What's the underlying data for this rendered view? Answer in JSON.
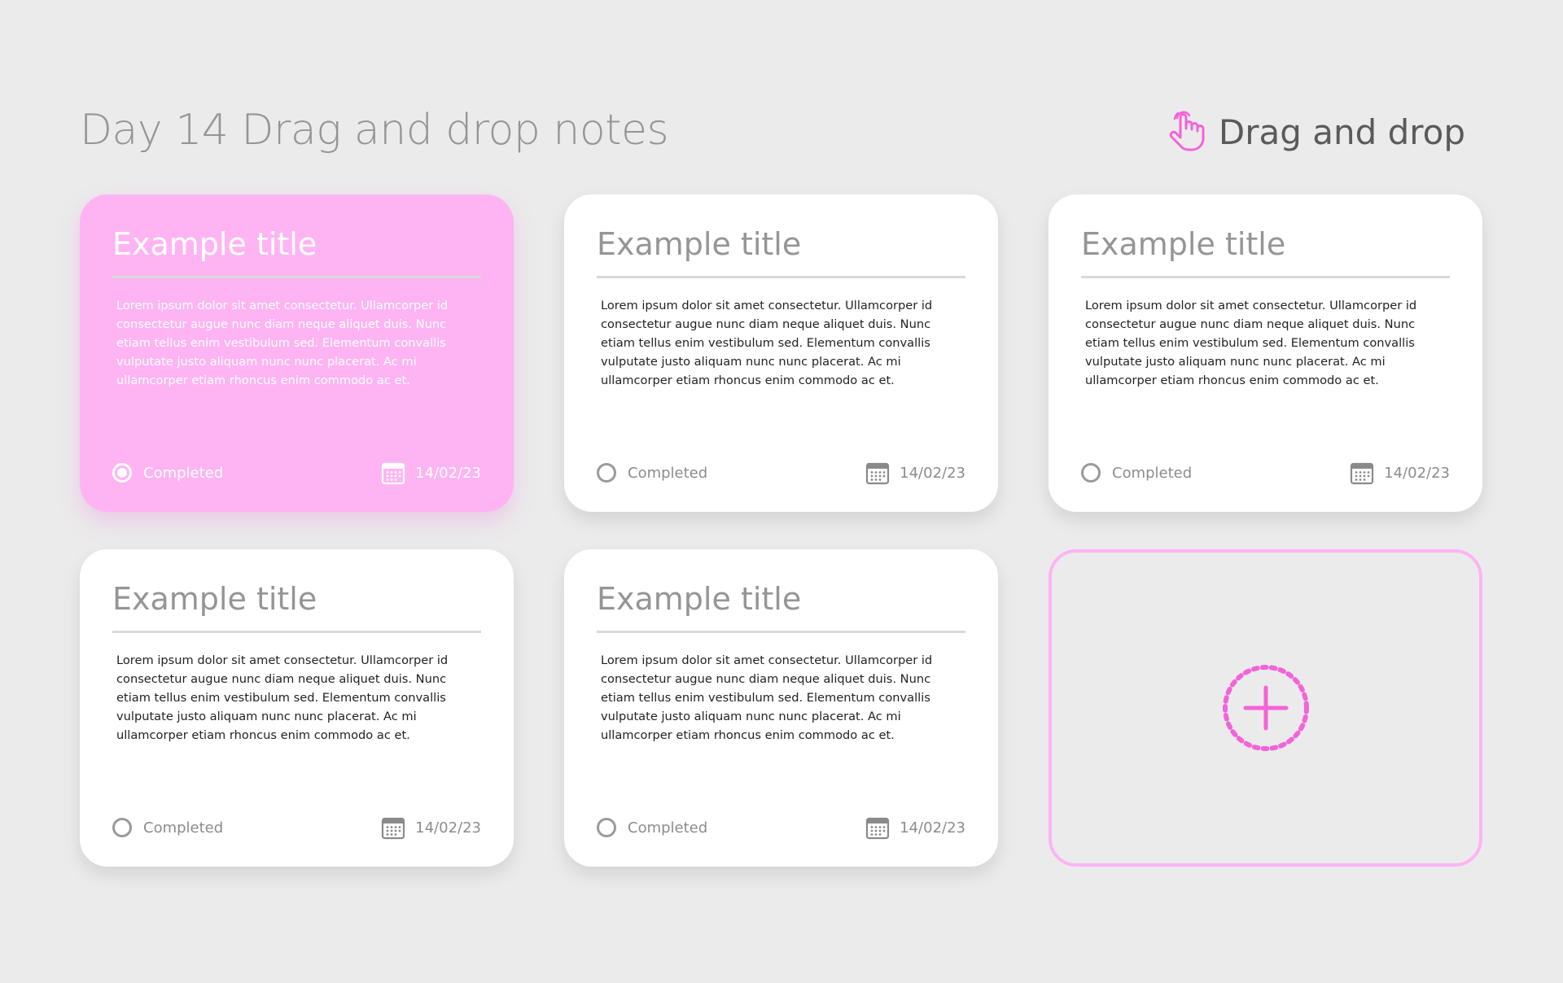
{
  "header": {
    "title": "Day 14 Drag and drop notes",
    "hint_label": "Drag and drop",
    "hint_icon": "pointer-hand-icon"
  },
  "colors": {
    "accent": "#f363d9",
    "active_card": "#feb4f3",
    "background": "#ebebeb",
    "card": "#ffffff"
  },
  "notes": [
    {
      "title": "Example title",
      "body": "Lorem ipsum dolor sit amet consectetur. Ullamcorper id consectetur augue nunc diam neque aliquet duis. Nunc etiam tellus enim vestibulum sed. Elementum convallis vulputate justo aliquam nunc nunc placerat. Ac mi ullamcorper etiam rhoncus enim commodo ac et.",
      "status_label": "Completed",
      "completed": true,
      "date": "14/02/23",
      "active": true
    },
    {
      "title": "Example title",
      "body": "Lorem ipsum dolor sit amet consectetur. Ullamcorper id consectetur augue nunc diam neque aliquet duis. Nunc etiam tellus enim vestibulum sed. Elementum convallis vulputate justo aliquam nunc nunc placerat. Ac mi ullamcorper etiam rhoncus enim commodo ac et.",
      "status_label": "Completed",
      "completed": false,
      "date": "14/02/23",
      "active": false
    },
    {
      "title": "Example title",
      "body": "Lorem ipsum dolor sit amet consectetur. Ullamcorper id consectetur augue nunc diam neque aliquet duis. Nunc etiam tellus enim vestibulum sed. Elementum convallis vulputate justo aliquam nunc nunc placerat. Ac mi ullamcorper etiam rhoncus enim commodo ac et.",
      "status_label": "Completed",
      "completed": false,
      "date": "14/02/23",
      "active": false
    },
    {
      "title": "Example title",
      "body": "Lorem ipsum dolor sit amet consectetur. Ullamcorper id consectetur augue nunc diam neque aliquet duis. Nunc etiam tellus enim vestibulum sed. Elementum convallis vulputate justo aliquam nunc nunc placerat. Ac mi ullamcorper etiam rhoncus enim commodo ac et.",
      "status_label": "Completed",
      "completed": false,
      "date": "14/02/23",
      "active": false
    },
    {
      "title": "Example title",
      "body": "Lorem ipsum dolor sit amet consectetur. Ullamcorper id consectetur augue nunc diam neque aliquet duis. Nunc etiam tellus enim vestibulum sed. Elementum convallis vulputate justo aliquam nunc nunc placerat. Ac mi ullamcorper etiam rhoncus enim commodo ac et.",
      "status_label": "Completed",
      "completed": false,
      "date": "14/02/23",
      "active": false
    }
  ],
  "add_slot": {
    "icon": "add-circle-icon"
  }
}
